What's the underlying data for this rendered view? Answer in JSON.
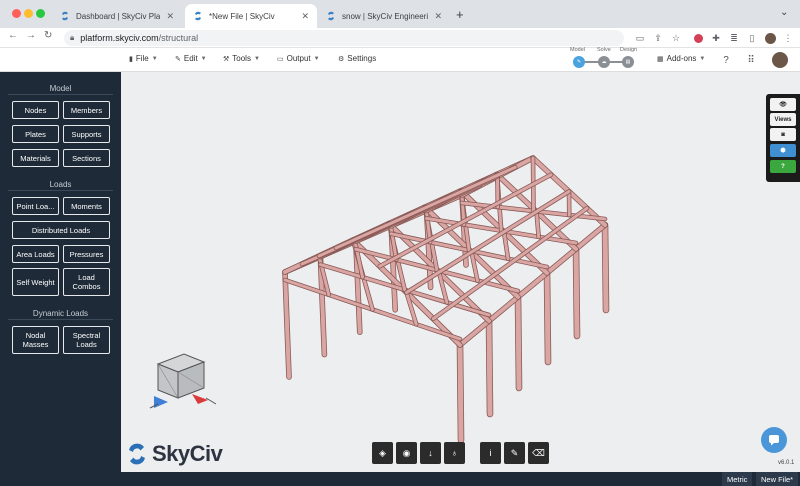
{
  "browser": {
    "tabs": [
      {
        "title": "Dashboard | SkyCiv Platform",
        "active": false
      },
      {
        "title": "*New File | SkyCiv",
        "active": true
      },
      {
        "title": "snow | SkyCiv Engineering",
        "active": false
      }
    ],
    "url_host": "platform.skyciv.com",
    "url_path": "/structural"
  },
  "menu": [
    {
      "label": "File",
      "icon": "file-icon"
    },
    {
      "label": "Edit",
      "icon": "pencil-icon"
    },
    {
      "label": "Tools",
      "icon": "wrench-icon"
    },
    {
      "label": "Output",
      "icon": "monitor-icon"
    },
    {
      "label": "Settings",
      "icon": "gear-icon"
    }
  ],
  "modes": [
    "Model",
    "Solve",
    "Design"
  ],
  "addons_label": "Add-ons",
  "sidebar": {
    "sections": [
      "Model",
      "Loads",
      "Dynamic Loads"
    ],
    "buttons": {
      "nodes": "Nodes",
      "members": "Members",
      "plates": "Plates",
      "supports": "Supports",
      "materials": "Materials",
      "sections": "Sections",
      "point_loads": "Point Loa...",
      "moments": "Moments",
      "distributed_loads": "Distributed Loads",
      "area_loads": "Area Loads",
      "pressures": "Pressures",
      "self_weight": "Self Weight",
      "load_combos": "Load Combos",
      "nodal_masses": "Nodal Masses",
      "spectral_loads": "Spectral Loads"
    }
  },
  "right_panel": {
    "views_label": "Views"
  },
  "logo_text": "SkyCiv",
  "version": "v6.0.1",
  "status": {
    "units": "Metric",
    "file": "New File*"
  },
  "colors": {
    "member": "#d9a6a3",
    "member_edge": "#8a5a57",
    "sidebar": "#1e2a38",
    "accent": "#4aa3df"
  }
}
